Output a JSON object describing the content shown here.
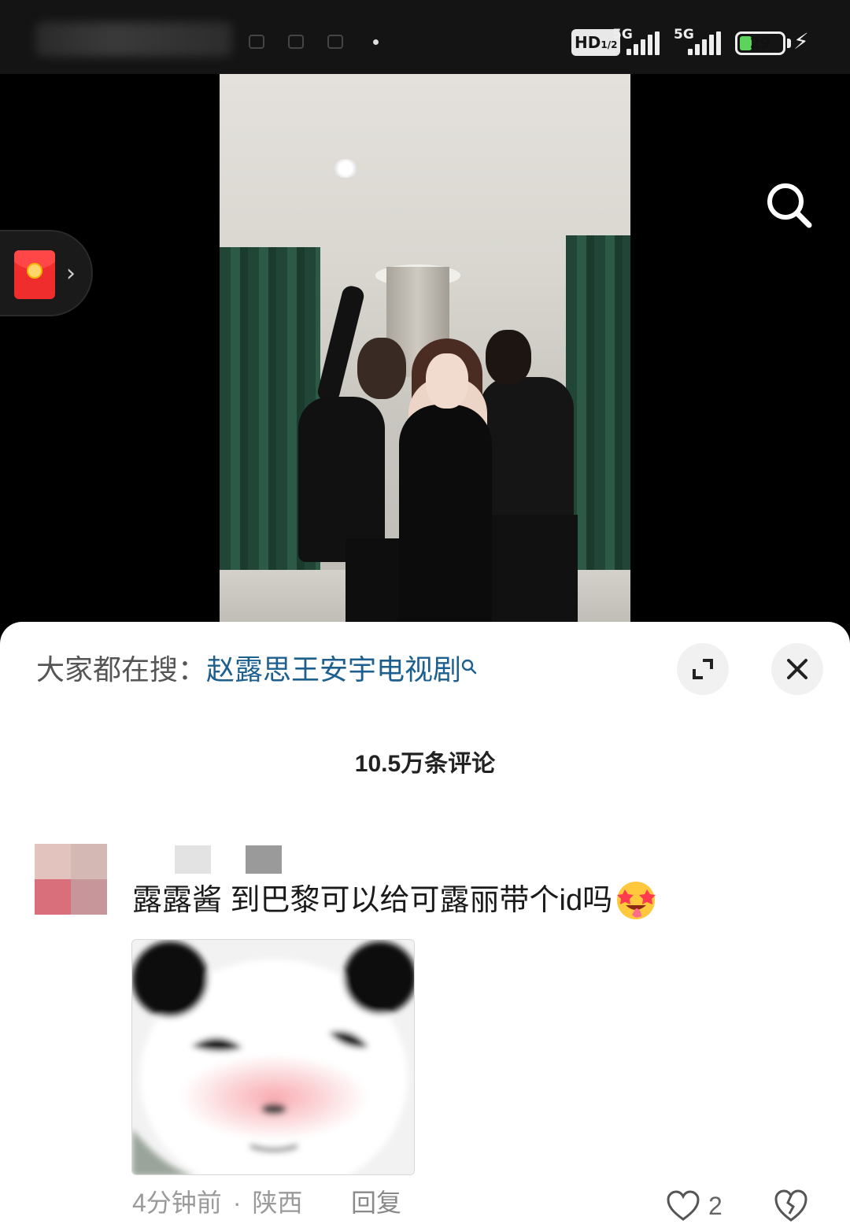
{
  "status_bar": {
    "hd_label": "HD",
    "network_1": "5G",
    "network_2": "5G",
    "battery_level": "29",
    "battery_percent": 29,
    "charging": true
  },
  "video": {
    "search_icon": "search-icon",
    "red_packet_icon": "red-packet-icon",
    "red_packet_chevron": "›"
  },
  "comment_sheet": {
    "trending_prefix": "大家都在搜：",
    "trending_query": "赵露思王安宇电视剧",
    "expand_icon": "expand-icon",
    "close_icon": "close-icon",
    "comment_count": "10.5万条评论",
    "comments": [
      {
        "text": "露露酱 到巴黎可以给可露丽带个id吗",
        "emoji": "star-struck-tongue-emoji",
        "sticker": "panda-meme-sticker",
        "time": "4分钟前",
        "separator": "·",
        "location": "陕西",
        "reply_label": "回复",
        "likes": "2"
      }
    ]
  },
  "colors": {
    "link_blue": "#1d5f8f",
    "meta_gray": "#9a9a9a",
    "sheet_bg": "#ffffff",
    "status_bg": "#141414"
  }
}
